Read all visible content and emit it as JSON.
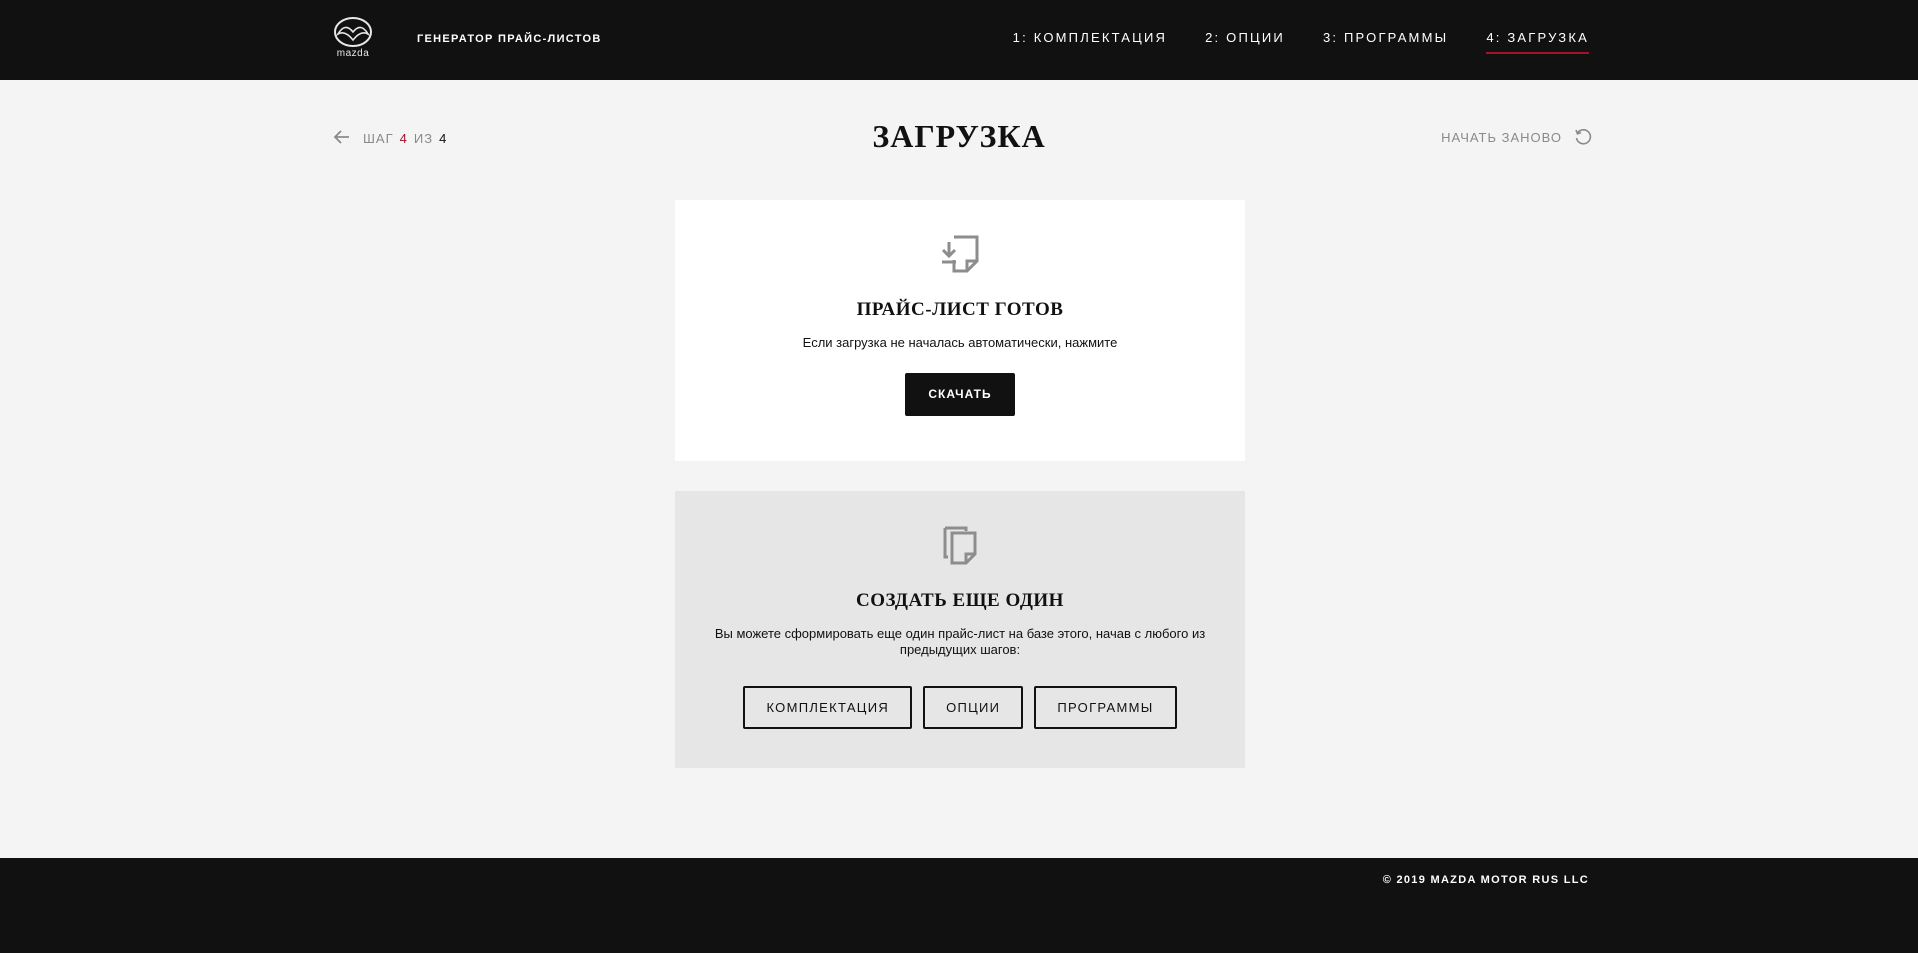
{
  "header": {
    "logo_text": "mazda",
    "app_title": "ГЕНЕРАТОР ПРАЙС-ЛИСТОВ",
    "nav": [
      {
        "label": "1: КОМПЛЕКТАЦИЯ"
      },
      {
        "label": "2: ОПЦИИ"
      },
      {
        "label": "3: ПРОГРАММЫ"
      },
      {
        "label": "4: ЗАГРУЗКА",
        "active": true
      }
    ]
  },
  "step": {
    "prefix": "ШАГ",
    "current": "4",
    "separator": "ИЗ",
    "total": "4"
  },
  "page_title": "ЗАГРУЗКА",
  "restart_label": "НАЧАТЬ ЗАНОВО",
  "ready_card": {
    "title": "ПРАЙС-ЛИСТ ГОТОВ",
    "text": "Если загрузка не началась автоматически, нажмите",
    "download_button": "СКАЧАТЬ"
  },
  "create_card": {
    "title": "СОЗДАТЬ ЕЩЕ ОДИН",
    "text": "Вы можете сформировать еще один прайс-лист на базе этого, начав с любого из предыдущих шагов:",
    "buttons": [
      "КОМПЛЕКТАЦИЯ",
      "ОПЦИИ",
      "ПРОГРАММЫ"
    ]
  },
  "footer": {
    "copyright": "© 2019 MAZDA MOTOR RUS LLC"
  },
  "colors": {
    "header_bg": "#111111",
    "page_bg": "#f4f4f4",
    "accent": "#a1142b",
    "create_card_bg": "#e6e6e6"
  },
  "icons": {
    "logo": "mazda-logo",
    "back": "arrow-left-icon",
    "restart": "refresh-icon",
    "download": "download-file-icon",
    "copy": "copy-file-icon"
  }
}
